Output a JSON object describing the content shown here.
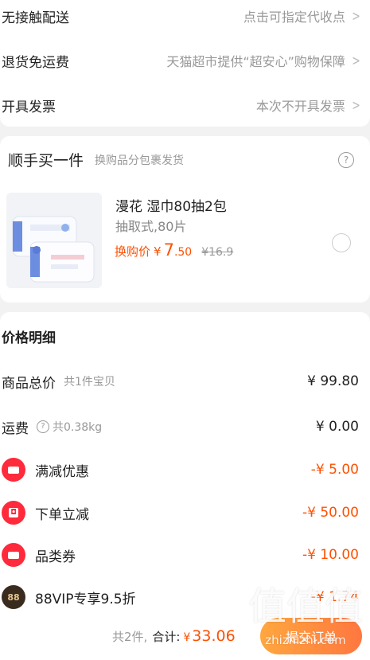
{
  "delivery": {
    "rows": [
      {
        "label": "无接触配送",
        "value": "点击可指定代收点"
      },
      {
        "label": "退货免运费",
        "value": "天猫超市提供“超安心”购物保障"
      },
      {
        "label": "开具发票",
        "value": "本次不开具发票"
      }
    ]
  },
  "addon": {
    "title": "顺手买一件",
    "subtitle": "换购品分包裹发货",
    "product": {
      "name": "漫花 湿巾80抽2包",
      "spec": "抽取式,80片",
      "price_label": "换购价",
      "currency": "¥",
      "price_int": "7",
      "price_dec": ".50",
      "old_price": "¥16.9",
      "image_icon": "wet-wipes-package-icon",
      "selected": false
    }
  },
  "price_detail": {
    "title": "价格明细",
    "goods": {
      "label": "商品总价",
      "note": "共1件宝贝",
      "amount": "¥ 99.80"
    },
    "shipping": {
      "label": "运费",
      "note": "共0.38kg",
      "amount": "¥ 0.00"
    },
    "discounts": [
      {
        "label": "满减优惠",
        "amount": "-¥ 5.00",
        "icon": "coupon-ticket-icon"
      },
      {
        "label": "下单立减",
        "amount": "-¥ 50.00",
        "icon": "red-envelope-icon"
      },
      {
        "label": "品类券",
        "amount": "-¥ 10.00",
        "icon": "coupon-ticket-icon"
      },
      {
        "label": "88VIP专享9.5折",
        "amount": "-¥ 1.74",
        "icon": "vip-88-icon",
        "icon_text": "88"
      }
    ]
  },
  "footer": {
    "count": "共2件,",
    "total_label": "合计:",
    "currency": "¥",
    "total": "33.06",
    "submit_label": "提交订单"
  },
  "watermark": {
    "glyphs": "值值值",
    "url": "zhizhizhi.com"
  },
  "colors": {
    "accent": "#ff5000",
    "badge_red": "#ff2a3b",
    "vip_bg": "#3a2b1f",
    "vip_text": "#e7c48c"
  }
}
